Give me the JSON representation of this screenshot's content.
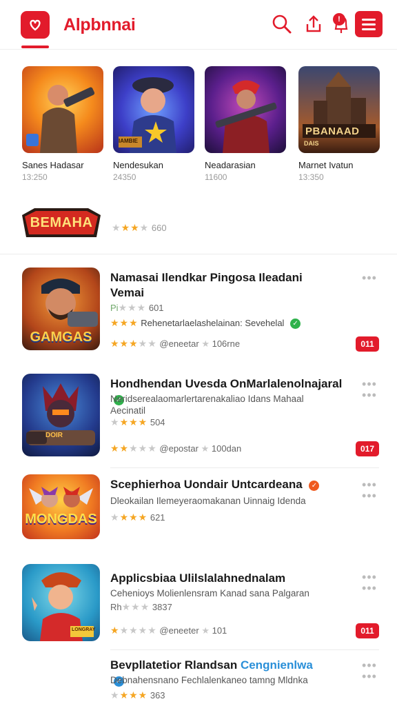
{
  "header": {
    "app_name": "Alpbnnai",
    "notif_count": "!",
    "icons": [
      "logo-icon",
      "search-icon",
      "upload-icon",
      "notification-icon",
      "menu-icon"
    ],
    "brand_color": "#e21b2b"
  },
  "featured": [
    {
      "name": "Sanes Hadasar",
      "count": "13:250",
      "badge": "",
      "banner": ""
    },
    {
      "name": "Nendesukan",
      "count": "24350",
      "badge": "",
      "banner": "IAMBIE"
    },
    {
      "name": "Neadarasian",
      "count": "11600",
      "badge": "",
      "banner": ""
    },
    {
      "name": "Marnet Ivatun",
      "count": "13:350",
      "badge": "DAIS",
      "banner": "PBANAAD"
    }
  ],
  "promo": {
    "logo_text": "BEMAHA",
    "rating_value": "660",
    "stars": 3
  },
  "apps": [
    {
      "title": "Namasai Ilendkar Pingosa Ileadani",
      "subtitle": "Vemai",
      "line1_prefix": "Pi",
      "line1_rating": "601",
      "line1_stars": 1,
      "line2_text": "Rehenetarlaelashelainan: Sevehelal",
      "line2_stars": 3,
      "line3_publisher": "@eneetar",
      "line3_downloads": "106rne",
      "line3_stars": 3,
      "pill": "011",
      "icon_text": "GAMGAS"
    },
    {
      "title": "Hondhendan Uvesda OnMarlalenolnajaral",
      "subtitle": "Neridserealaomarlertarenakaliao Idans Mahaal Aecinatil",
      "line1_rating": "504",
      "line1_stars": 3,
      "line3_publisher": "@epostar",
      "line3_downloads": "100dan",
      "line3_stars": 2,
      "pill": "017",
      "icon_text": "DOIR"
    },
    {
      "title": "Scephierhoa Uondair Untcardeana",
      "subtitle": "Dleokailan Ilemeyeraomakanan Uinnaig Idenda",
      "line1_rating": "621",
      "line1_stars": 3,
      "icon_text": "MONGDAS"
    },
    {
      "title": "Applicsbiaa Ulilslalahnednalam",
      "subtitle": "Cehenioys Molienlensram Kanad sana Palgaran",
      "line1_prefix": "Rh",
      "line1_rating": "3837",
      "line1_stars": 1,
      "line3_publisher": "@eneeter",
      "line3_downloads": "101",
      "line3_stars": 1,
      "pill": "011",
      "icon_text": "LONGRAY"
    },
    {
      "title": "Bevpllatetior Rlandsan",
      "title_accent": "Cengnienlwa",
      "subtitle": "Debnahensnano Fechlalenkaneo tamng Mldnka",
      "line1_rating": "363",
      "line1_stars": 3
    }
  ],
  "colors": {
    "accent": "#e21b2b",
    "star": "#f5a623",
    "verified_green": "#2fb24c",
    "verified_orange": "#ef5a1f",
    "verified_blue": "#2a8fd8"
  }
}
